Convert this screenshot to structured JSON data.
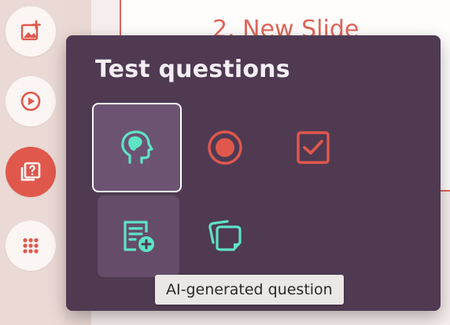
{
  "slide": {
    "title": "2. New Slide"
  },
  "left_toolbar": {
    "buttons": [
      {
        "icon": "add-image-icon",
        "active": false
      },
      {
        "icon": "play-icon",
        "active": false
      },
      {
        "icon": "question-stack-icon",
        "active": true
      },
      {
        "icon": "apps-grid-icon",
        "active": false
      }
    ]
  },
  "popover": {
    "title": "Test questions",
    "tiles": [
      {
        "icon": "brain-head-icon",
        "state": "selected"
      },
      {
        "icon": "radio-button-icon",
        "state": "normal"
      },
      {
        "icon": "checkbox-icon",
        "state": "normal"
      },
      {
        "icon": "document-add-icon",
        "state": "hover"
      },
      {
        "icon": "stacked-cards-icon",
        "state": "normal"
      }
    ]
  },
  "tooltip": {
    "text": "AI-generated question"
  },
  "colors": {
    "accent_coral": "#e0584c",
    "accent_mint": "#5fe3c6",
    "popover_bg": "#4f3a52"
  }
}
